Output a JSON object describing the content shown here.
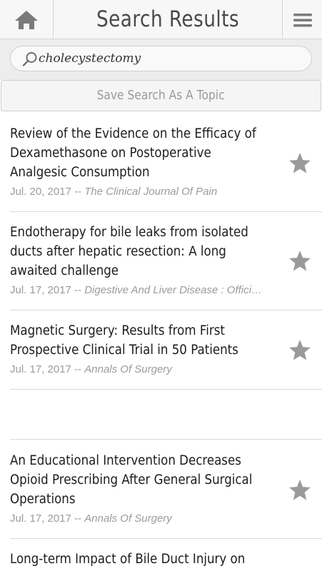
{
  "header": {
    "title": "Search Results",
    "home_icon": "home-icon",
    "menu_icon": "hamburger-menu-icon"
  },
  "search": {
    "value": "cholecystectomy",
    "icon": "search-icon"
  },
  "save_topic": {
    "label": "Save Search As A Topic"
  },
  "colors": {
    "star": "#9a9a9a",
    "meta_text": "#9b9b9b",
    "divider": "#d9d9d9"
  },
  "results": [
    {
      "title_lines": [
        "Review of the Evidence on the Efficacy of",
        "Dexamethasone on Postoperative",
        "Analgesic Consumption"
      ],
      "date": "Jul. 20, 2017",
      "separator": "--",
      "journal": "The Clinical Journal Of Pain"
    },
    {
      "title_lines": [
        "Endotherapy for bile leaks from isolated",
        "ducts after hepatic resection: A long",
        "awaited challenge"
      ],
      "date": "Jul. 17, 2017",
      "separator": "--",
      "journal": "Digestive And Liver Disease : Offici…"
    },
    {
      "title_lines": [
        "Magnetic Surgery: Results from First",
        "Prospective Clinical Trial in 50 Patients"
      ],
      "date": "Jul. 17, 2017",
      "separator": "--",
      "journal": "Annals Of Surgery"
    },
    {
      "title_lines": [
        "An Educational Intervention Decreases",
        "Opioid Prescribing After General Surgical",
        "Operations"
      ],
      "date": "Jul. 17, 2017",
      "separator": "--",
      "journal": "Annals Of Surgery"
    },
    {
      "title_lines": [
        "Long-term Impact of Bile Duct Injury on"
      ]
    }
  ]
}
